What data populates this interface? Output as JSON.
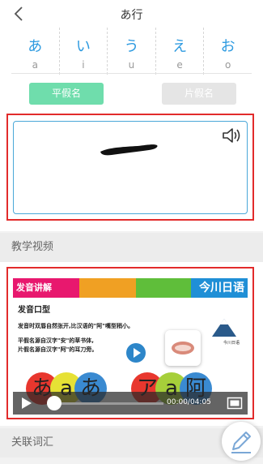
{
  "header": {
    "title": "あ行",
    "back_icon": "chevron-left-icon"
  },
  "kana_tabs": [
    {
      "kana": "あ",
      "romaji": "a"
    },
    {
      "kana": "い",
      "romaji": "i"
    },
    {
      "kana": "う",
      "romaji": "u"
    },
    {
      "kana": "え",
      "romaji": "e"
    },
    {
      "kana": "お",
      "romaji": "o"
    }
  ],
  "script_toggle": {
    "hiragana_label": "平假名",
    "katakana_label": "片假名",
    "active": "hiragana"
  },
  "writing_pad": {
    "speaker_icon": "speaker-icon"
  },
  "sections": {
    "video_title": "教学视频",
    "vocab_title": "关联词汇"
  },
  "video": {
    "banner_title": "发音讲解",
    "brand": "今川日语",
    "subtitle": "发音口型",
    "lines": [
      "发音时双唇自然张开,比汉语的\"阿\"嘴型稍小。",
      "平假名源自汉字\"安\"的草书体,",
      "片假名源自汉字\"阿\"的耳刀旁。"
    ],
    "logo_text": "今川日语",
    "balls": [
      {
        "char": "あ",
        "color": "#e8372e"
      },
      {
        "char": "a",
        "color": "#e6e135"
      },
      {
        "char": "あ",
        "color": "#3a8ad1"
      },
      {
        "char": "ア",
        "color": "#e8372e"
      },
      {
        "char": "a",
        "color": "#a6cf3a"
      },
      {
        "char": "阿",
        "color": "#3a8ad1"
      }
    ],
    "time": "00:00/04:05",
    "progress": 0,
    "colors": {
      "banner_pink": "#e8186e",
      "banner_orange": "#f0a023",
      "banner_green": "#5fbe3a",
      "banner_blue": "#1f8fd6"
    }
  },
  "colors": {
    "accent": "#2d9ae0",
    "hira_active": "#6fddac",
    "highlight": "#e22b2b"
  },
  "floating_icon": "pencil-icon"
}
